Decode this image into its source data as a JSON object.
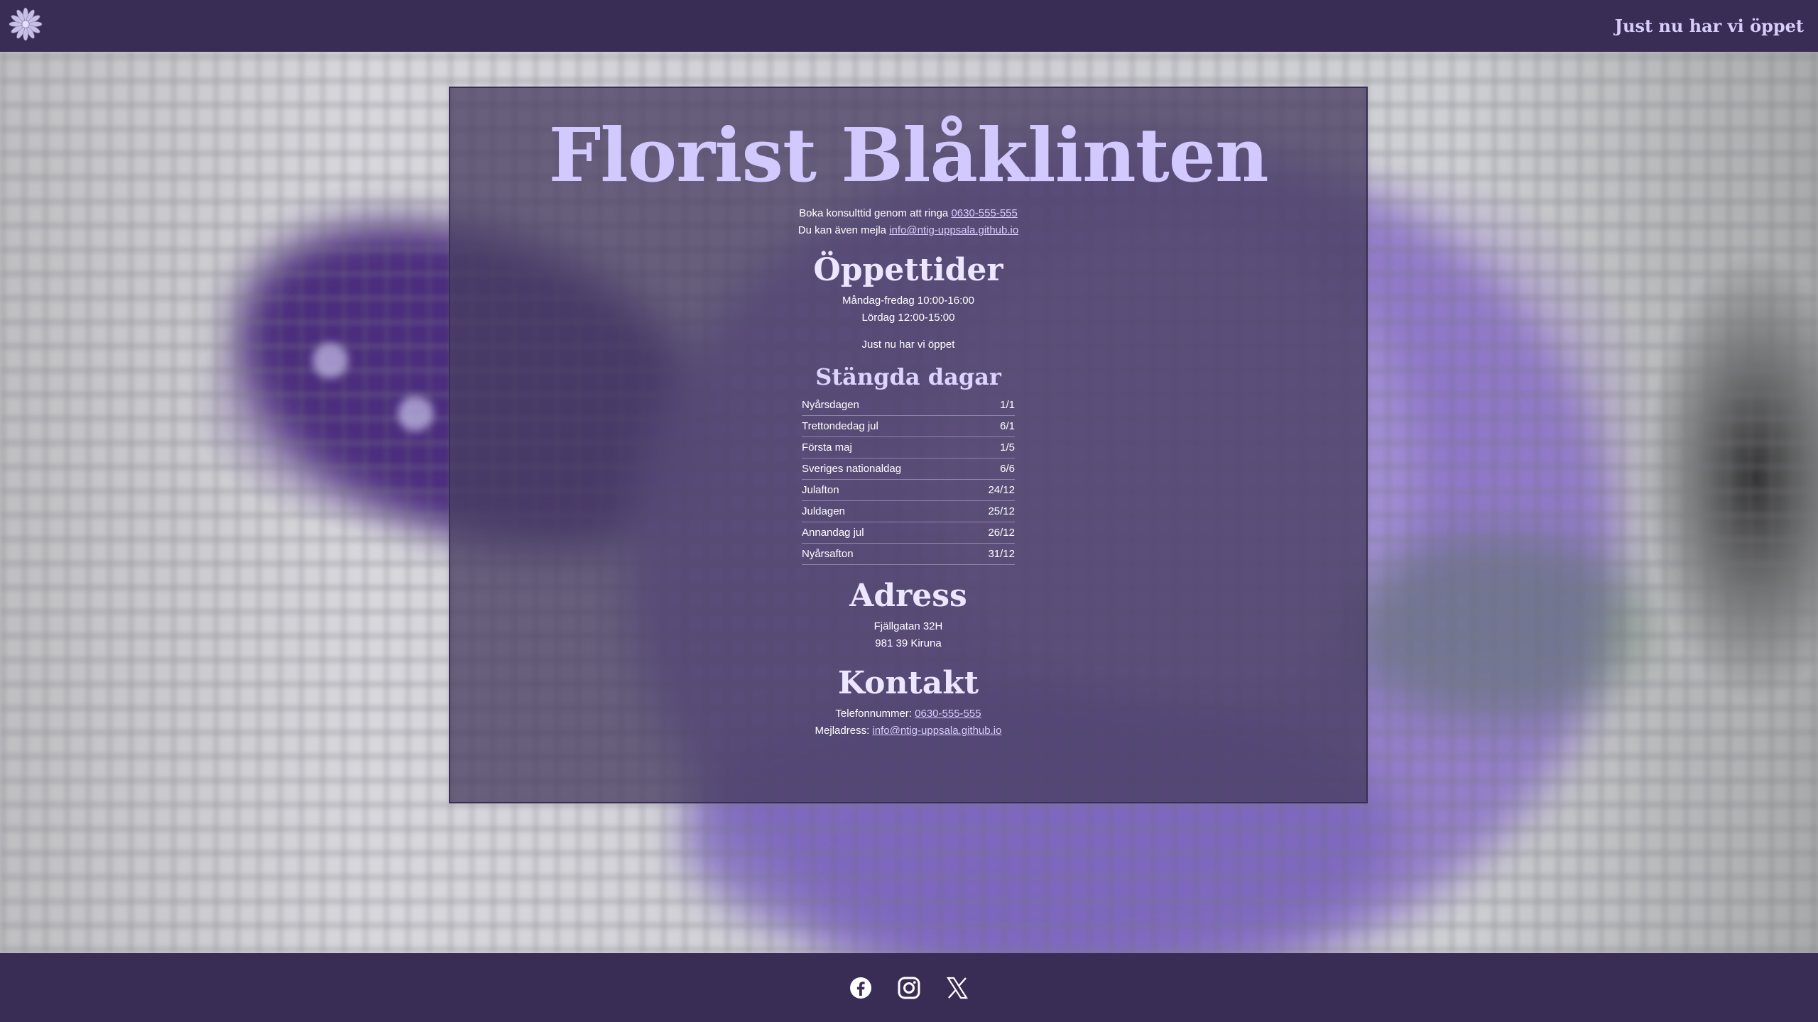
{
  "header": {
    "status_text": "Just nu har vi öppet"
  },
  "main": {
    "title": "Florist Blåklinten",
    "intro": {
      "book_text": "Boka konsulttid genom att ringa",
      "phone_link": "0630-555-555",
      "mail_text": "Du kan även mejla",
      "email_link": "info@ntig-uppsala.github.io"
    },
    "opening_hours": {
      "heading": "Öppettider",
      "lines": [
        "Måndag-fredag 10:00-16:00",
        "Lördag 12:00-15:00"
      ],
      "status_text": "Just nu har vi öppet"
    },
    "closed_days": {
      "heading": "Stängda dagar",
      "rows": [
        {
          "name": "Nyårsdagen",
          "date": "1/1"
        },
        {
          "name": "Trettondedag jul",
          "date": "6/1"
        },
        {
          "name": "Första maj",
          "date": "1/5"
        },
        {
          "name": "Sveriges nationaldag",
          "date": "6/6"
        },
        {
          "name": "Julafton",
          "date": "24/12"
        },
        {
          "name": "Juldagen",
          "date": "25/12"
        },
        {
          "name": "Annandag jul",
          "date": "26/12"
        },
        {
          "name": "Nyårsafton",
          "date": "31/12"
        }
      ]
    },
    "address": {
      "heading": "Adress",
      "street": "Fjällgatan 32H",
      "city": "981 39 Kiruna"
    },
    "contact": {
      "heading": "Kontakt",
      "phone_label": "Telefonnummer:",
      "phone": "0630-555-555",
      "email_label": "Mejladress:",
      "email": "info@ntig-uppsala.github.io"
    }
  },
  "footer": {
    "icons": [
      "facebook-icon",
      "instagram-icon",
      "x-icon"
    ]
  },
  "colors": {
    "bar": "#3a2d55",
    "title": "#d2c9ff",
    "link": "#d8cdfc"
  }
}
